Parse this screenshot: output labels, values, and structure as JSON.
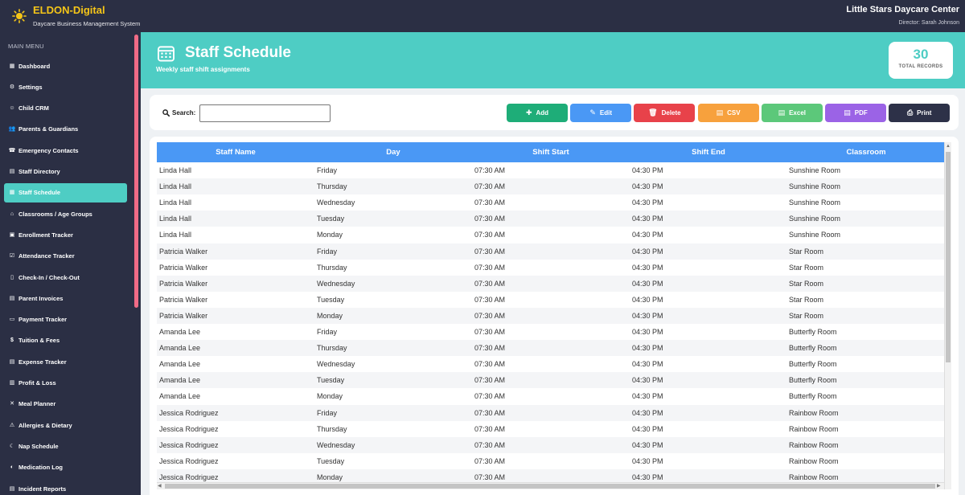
{
  "app": {
    "brand": "ELDON-Digital",
    "brand_subtitle": "Daycare Business Management System",
    "org_name": "Little Stars Daycare Center",
    "director": "Director: Sarah Johnson"
  },
  "sidebar": {
    "heading": "MAIN MENU",
    "items": [
      {
        "label": "Dashboard",
        "icon": "dashboard-icon"
      },
      {
        "label": "Settings",
        "icon": "gear-icon"
      },
      {
        "label": "Child CRM",
        "icon": "child-icon"
      },
      {
        "label": "Parents & Guardians",
        "icon": "users-icon"
      },
      {
        "label": "Emergency Contacts",
        "icon": "phone-icon"
      },
      {
        "label": "Staff Directory",
        "icon": "id-card-icon"
      },
      {
        "label": "Staff Schedule",
        "icon": "calendar-icon",
        "active": true
      },
      {
        "label": "Classrooms / Age Groups",
        "icon": "school-icon"
      },
      {
        "label": "Enrollment Tracker",
        "icon": "clipboard-icon"
      },
      {
        "label": "Attendance Tracker",
        "icon": "checkbox-icon"
      },
      {
        "label": "Check-In / Check-Out",
        "icon": "door-icon"
      },
      {
        "label": "Parent Invoices",
        "icon": "invoice-icon"
      },
      {
        "label": "Payment Tracker",
        "icon": "card-icon"
      },
      {
        "label": "Tuition & Fees",
        "icon": "money-icon"
      },
      {
        "label": "Expense Tracker",
        "icon": "receipt-icon"
      },
      {
        "label": "Profit & Loss",
        "icon": "chart-icon"
      },
      {
        "label": "Meal Planner",
        "icon": "utensils-icon"
      },
      {
        "label": "Allergies & Dietary",
        "icon": "warning-icon"
      },
      {
        "label": "Nap Schedule",
        "icon": "moon-icon"
      },
      {
        "label": "Medication Log",
        "icon": "pill-icon"
      },
      {
        "label": "Incident Reports",
        "icon": "report-icon"
      }
    ]
  },
  "header": {
    "title": "Staff Schedule",
    "subtitle": "Weekly staff shift assignments",
    "record_count": "30",
    "record_label": "TOTAL RECORDS"
  },
  "toolbar": {
    "search_label": "Search:",
    "search_value": "",
    "buttons": [
      {
        "label": "Add",
        "color": "#1ead78",
        "icon": "plus-icon"
      },
      {
        "label": "Edit",
        "color": "#4a98f5",
        "icon": "edit-icon"
      },
      {
        "label": "Delete",
        "color": "#e8424a",
        "icon": "trash-icon"
      },
      {
        "label": "CSV",
        "color": "#f7a13d",
        "icon": "file-csv-icon"
      },
      {
        "label": "Excel",
        "color": "#5cc87a",
        "icon": "file-excel-icon"
      },
      {
        "label": "PDF",
        "color": "#9b63e6",
        "icon": "file-pdf-icon"
      },
      {
        "label": "Print",
        "color": "#2d3148",
        "icon": "print-icon"
      }
    ]
  },
  "table": {
    "columns": [
      "Staff Name",
      "Day",
      "Shift Start",
      "Shift End",
      "Classroom"
    ],
    "rows": [
      [
        "Linda Hall",
        "Friday",
        "07:30 AM",
        "04:30 PM",
        "Sunshine Room"
      ],
      [
        "Linda Hall",
        "Thursday",
        "07:30 AM",
        "04:30 PM",
        "Sunshine Room"
      ],
      [
        "Linda Hall",
        "Wednesday",
        "07:30 AM",
        "04:30 PM",
        "Sunshine Room"
      ],
      [
        "Linda Hall",
        "Tuesday",
        "07:30 AM",
        "04:30 PM",
        "Sunshine Room"
      ],
      [
        "Linda Hall",
        "Monday",
        "07:30 AM",
        "04:30 PM",
        "Sunshine Room"
      ],
      [
        "Patricia Walker",
        "Friday",
        "07:30 AM",
        "04:30 PM",
        "Star Room"
      ],
      [
        "Patricia Walker",
        "Thursday",
        "07:30 AM",
        "04:30 PM",
        "Star Room"
      ],
      [
        "Patricia Walker",
        "Wednesday",
        "07:30 AM",
        "04:30 PM",
        "Star Room"
      ],
      [
        "Patricia Walker",
        "Tuesday",
        "07:30 AM",
        "04:30 PM",
        "Star Room"
      ],
      [
        "Patricia Walker",
        "Monday",
        "07:30 AM",
        "04:30 PM",
        "Star Room"
      ],
      [
        "Amanda Lee",
        "Friday",
        "07:30 AM",
        "04:30 PM",
        "Butterfly Room"
      ],
      [
        "Amanda Lee",
        "Thursday",
        "07:30 AM",
        "04:30 PM",
        "Butterfly Room"
      ],
      [
        "Amanda Lee",
        "Wednesday",
        "07:30 AM",
        "04:30 PM",
        "Butterfly Room"
      ],
      [
        "Amanda Lee",
        "Tuesday",
        "07:30 AM",
        "04:30 PM",
        "Butterfly Room"
      ],
      [
        "Amanda Lee",
        "Monday",
        "07:30 AM",
        "04:30 PM",
        "Butterfly Room"
      ],
      [
        "Jessica Rodriguez",
        "Friday",
        "07:30 AM",
        "04:30 PM",
        "Rainbow Room"
      ],
      [
        "Jessica Rodriguez",
        "Thursday",
        "07:30 AM",
        "04:30 PM",
        "Rainbow Room"
      ],
      [
        "Jessica Rodriguez",
        "Wednesday",
        "07:30 AM",
        "04:30 PM",
        "Rainbow Room"
      ],
      [
        "Jessica Rodriguez",
        "Tuesday",
        "07:30 AM",
        "04:30 PM",
        "Rainbow Room"
      ],
      [
        "Jessica Rodriguez",
        "Monday",
        "07:30 AM",
        "04:30 PM",
        "Rainbow Room"
      ]
    ]
  }
}
